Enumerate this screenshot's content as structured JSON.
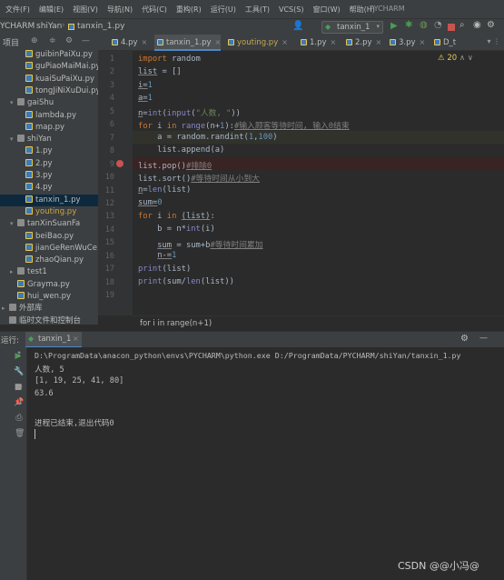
{
  "menubar": {
    "items": [
      "文件(F)",
      "编辑(E)",
      "视图(V)",
      "导航(N)",
      "代码(C)",
      "重构(R)",
      "运行(U)",
      "工具(T)",
      "VCS(S)",
      "窗口(W)",
      "帮助(H)"
    ],
    "app_name": "PYCHARM"
  },
  "navbar": {
    "project": "YCHARM",
    "folder": "shiYan",
    "file": "tanxin_1.py",
    "run_config": "tanxin_1"
  },
  "project_tree": [
    {
      "label": "guibinPaiXu.py",
      "type": "py",
      "indent": 2
    },
    {
      "label": "guPiaoMaiMai.py",
      "type": "py",
      "indent": 2
    },
    {
      "label": "kuaiSuPaiXu.py",
      "type": "py",
      "indent": 2
    },
    {
      "label": "tongJiNiXuDui.py",
      "type": "py",
      "indent": 2
    },
    {
      "label": "gaiShu",
      "type": "folder",
      "indent": 1,
      "arrow": "▾"
    },
    {
      "label": "lambda.py",
      "type": "py",
      "indent": 2
    },
    {
      "label": "map.py",
      "type": "py",
      "indent": 2
    },
    {
      "label": "shiYan",
      "type": "folder",
      "indent": 1,
      "arrow": "▾"
    },
    {
      "label": "1.py",
      "type": "py",
      "indent": 2
    },
    {
      "label": "2.py",
      "type": "py",
      "indent": 2
    },
    {
      "label": "3.py",
      "type": "py",
      "indent": 2
    },
    {
      "label": "4.py",
      "type": "py",
      "indent": 2
    },
    {
      "label": "tanxin_1.py",
      "type": "py",
      "indent": 2,
      "selected": true
    },
    {
      "label": "youting.py",
      "type": "py",
      "indent": 2
    },
    {
      "label": "tanXinSuanFa",
      "type": "folder",
      "indent": 1,
      "arrow": "▾"
    },
    {
      "label": "beiBao.py",
      "type": "py",
      "indent": 2
    },
    {
      "label": "jianGeRenWuCe",
      "type": "py",
      "indent": 2
    },
    {
      "label": "zhaoQian.py",
      "type": "py",
      "indent": 2
    },
    {
      "label": "test1",
      "type": "folder",
      "indent": 1,
      "arrow": "▸"
    },
    {
      "label": "Grayma.py",
      "type": "py",
      "indent": 1
    },
    {
      "label": "hui_wen.py",
      "type": "py",
      "indent": 1
    },
    {
      "label": "外部库",
      "type": "folder",
      "indent": 0,
      "arrow": "▸"
    },
    {
      "label": "临时文件和控制台",
      "type": "folder",
      "indent": 0
    }
  ],
  "tabs": [
    "4.py",
    "tanxin_1.py",
    "youting.py",
    "1.py",
    "2.py",
    "3.py",
    "D_t"
  ],
  "editor": {
    "warning_count": "20",
    "line_numbers": [
      "1",
      "2",
      "3",
      "4",
      "5",
      "6",
      "7",
      "8",
      "9",
      "10",
      "11",
      "12",
      "13",
      "14",
      "15",
      "16",
      "17",
      "18",
      "19"
    ],
    "breadcrumb": "for i in range(n+1)"
  },
  "run": {
    "label": "运行:",
    "tab": "tanxin_1",
    "lines": [
      "D:\\ProgramData\\anacon_python\\envs\\PYCHARM\\python.exe D:/ProgramData/PYCHARM/shiYan/tanxin_1.py",
      "人数, 5",
      "[1, 19, 25, 41, 80]",
      "63.6",
      "",
      "进程已结束,退出代码0"
    ]
  },
  "watermark": "CSDN @@小冯@"
}
